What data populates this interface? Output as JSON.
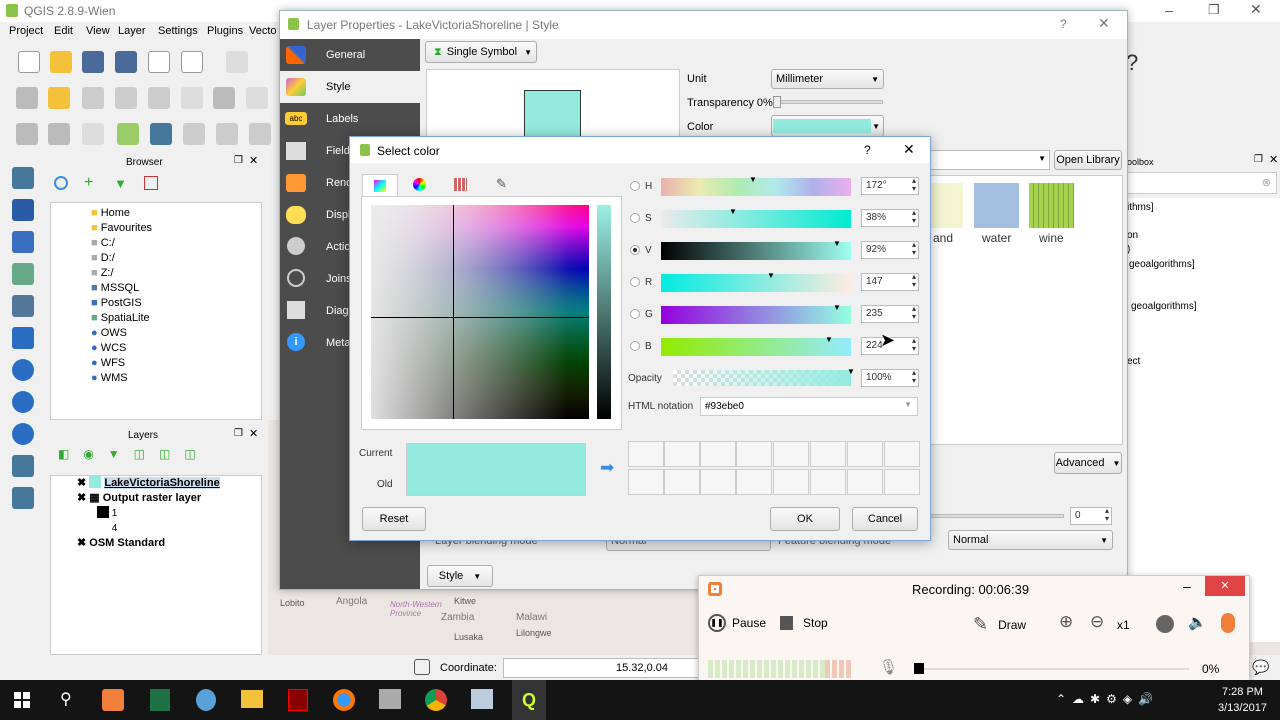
{
  "qgis": {
    "title": "QGIS 2.8.9-Wien",
    "menu": [
      "Project",
      "Edit",
      "View",
      "Layer",
      "Settings",
      "Plugins",
      "Vecto"
    ],
    "browser": {
      "title": "Browser",
      "items": [
        "Home",
        "Favourites",
        "C:/",
        "D:/",
        "Z:/",
        "MSSQL",
        "PostGIS",
        "SpatiaLite",
        "OWS",
        "WCS",
        "WFS",
        "WMS"
      ]
    },
    "layers": {
      "title": "Layers",
      "items": [
        "LakeVictoriaShoreline",
        "Output raster layer",
        "1",
        "4",
        "OSM Standard"
      ]
    },
    "status": {
      "coordinate_label": "Coordinate:",
      "coordinate_value": "15.32,0.04"
    },
    "map_labels": [
      "Lobito",
      "Angola",
      "North-Western Province",
      "Kitwe",
      "Zambia",
      "Lusaka",
      "Malawi",
      "Lilongwe"
    ]
  },
  "layer_props": {
    "title": "Layer Properties - LakeVictoriaShoreline | Style",
    "sidebar": [
      "General",
      "Style",
      "Labels",
      "Fields",
      "Rendering",
      "Display",
      "Actions",
      "Joins",
      "Diagrams",
      "Metadata"
    ],
    "renderer": "Single Symbol",
    "unit_label": "Unit",
    "unit_value": "Millimeter",
    "transparency_label": "Transparency 0%",
    "color_label": "Color",
    "open_library": "Open Library",
    "symbols": [
      "and",
      "water",
      "wine"
    ],
    "advanced": "Advanced",
    "blend_value": "0",
    "blend_mode": "Normal",
    "layer_blending": "Layer blending mode",
    "layer_blend_value": "Normal",
    "feature_blending": "Feature blending mode",
    "style_button": "Style"
  },
  "toolbox": {
    "title": "oolbox",
    "lines": [
      "ithms]",
      "on",
      ")",
      "geoalgorithms]",
      "geoalgorithms]",
      "ect"
    ]
  },
  "select_color": {
    "title": "Select color",
    "help": "?",
    "channels": [
      {
        "key": "H",
        "value": "172°"
      },
      {
        "key": "S",
        "value": "38%"
      },
      {
        "key": "V",
        "value": "92%"
      },
      {
        "key": "R",
        "value": "147"
      },
      {
        "key": "G",
        "value": "235"
      },
      {
        "key": "B",
        "value": "224"
      }
    ],
    "selected_channel": "V",
    "opacity_label": "Opacity",
    "opacity_value": "100%",
    "html_label": "HTML notation",
    "html_value": "#93ebe0",
    "current_label": "Current",
    "old_label": "Old",
    "reset": "Reset",
    "ok": "OK",
    "cancel": "Cancel",
    "color": "#93ebe0"
  },
  "recording": {
    "title": "Recording:  00:06:39",
    "pause": "Pause",
    "stop": "Stop",
    "draw": "Draw",
    "zoom": "x1",
    "progress": "0%"
  },
  "taskbar": {
    "time": "7:28 PM",
    "date": "3/13/2017"
  }
}
